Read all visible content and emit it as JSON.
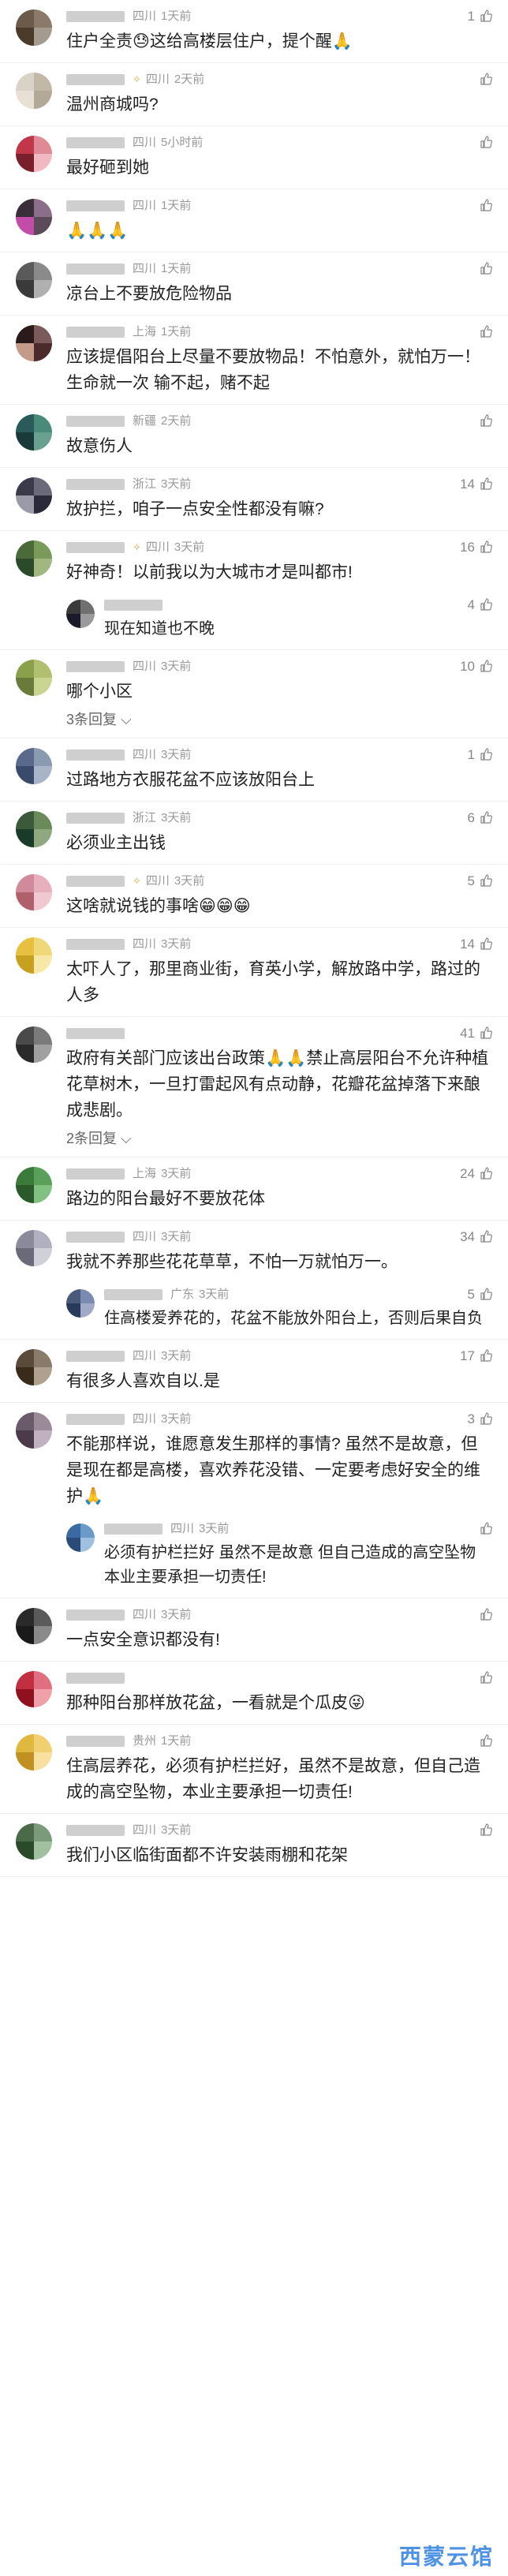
{
  "comments": [
    {
      "region": "四川",
      "time": "1天前",
      "likes": "1",
      "text": "住户全责😓这给高楼层住户，提个醒🙏",
      "av": [
        "#6b5b4b",
        "#8b7a6a",
        "#4a3a2a",
        "#a59a8f"
      ]
    },
    {
      "region": "四川",
      "time": "2天前",
      "likes": "",
      "badge": true,
      "text": "温州商城吗?",
      "av": [
        "#d9d2c6",
        "#c2b8a8",
        "#e8e0d4",
        "#b4a898"
      ]
    },
    {
      "region": "四川",
      "time": "5小时前",
      "likes": "",
      "text": "最好砸到她",
      "av": [
        "#c2364a",
        "#e08a96",
        "#7a1f2c",
        "#f0b8c0"
      ]
    },
    {
      "region": "四川",
      "time": "1天前",
      "likes": "",
      "text": "🙏🙏🙏",
      "av": [
        "#3a2e3a",
        "#8a6e8a",
        "#c24ca8",
        "#5a4a5a"
      ]
    },
    {
      "region": "四川",
      "time": "1天前",
      "likes": "",
      "text": "凉台上不要放危险物品",
      "av": [
        "#5a5a5a",
        "#8a8a8a",
        "#3a3a3a",
        "#b0b0b0"
      ]
    },
    {
      "region": "上海",
      "time": "1天前",
      "likes": "",
      "text": "应该提倡阳台上尽量不要放物品！不怕意外，就怕万一！生命就一次 输不起，赌不起",
      "av": [
        "#2a1a1a",
        "#7a5a5a",
        "#c49a8a",
        "#4a2a2a"
      ]
    },
    {
      "region": "新疆",
      "time": "2天前",
      "likes": "",
      "text": "故意伤人",
      "av": [
        "#2a5a5a",
        "#4a8a7a",
        "#1a3a3a",
        "#6aa090"
      ]
    },
    {
      "region": "浙江",
      "time": "3天前",
      "likes": "14",
      "text": "放护拦，咱子一点安全性都没有嘛?",
      "av": [
        "#3a3a4a",
        "#6a6a7a",
        "#9a9aa8",
        "#2a2a3a"
      ]
    },
    {
      "region": "四川",
      "time": "3天前",
      "likes": "16",
      "badge": true,
      "text": "好神奇！以前我以为大城市才是叫都市!",
      "av": [
        "#4a6a3a",
        "#7a9a5a",
        "#2a4a2a",
        "#a0b880"
      ],
      "sub": {
        "likes": "4",
        "text": "现在知道也不晚",
        "av": [
          "#3a3a3a",
          "#707070",
          "#1a1a2a",
          "#9a9a9a"
        ]
      }
    },
    {
      "region": "四川",
      "time": "3天前",
      "likes": "10",
      "text": "哪个小区",
      "reply": "3条回复",
      "av": [
        "#8aa04a",
        "#b0c070",
        "#6a7a3a",
        "#c8d490"
      ]
    },
    {
      "region": "四川",
      "time": "3天前",
      "likes": "1",
      "text": "过路地方衣服花盆不应该放阳台上",
      "av": [
        "#5a6a8a",
        "#8a9ab0",
        "#3a4a6a",
        "#aab4c8"
      ]
    },
    {
      "region": "浙江",
      "time": "3天前",
      "likes": "6",
      "text": "必须业主出钱",
      "av": [
        "#3a5a3a",
        "#6a8a5a",
        "#1a3a2a",
        "#90a880"
      ]
    },
    {
      "region": "四川",
      "time": "3天前",
      "likes": "5",
      "badge": true,
      "text": "这啥就说钱的事啥😁😁😁",
      "av": [
        "#d08a9a",
        "#e8b0bc",
        "#b0606a",
        "#f0c8d0"
      ]
    },
    {
      "region": "四川",
      "time": "3天前",
      "likes": "14",
      "text": "太吓人了，那里商业街，育英小学，解放路中学，路过的人多",
      "av": [
        "#e8c040",
        "#f0d878",
        "#c8a020",
        "#f8e8a8"
      ]
    },
    {
      "region": "",
      "time": "",
      "likes": "41",
      "text": "政府有关部门应该出台政策🙏🙏禁止高层阳台不允许种植花草树木，一旦打雷起风有点动静，花瓣花盆掉落下来酿成悲剧。",
      "reply": "2条回复",
      "av": [
        "#4a4a4a",
        "#7a7a7a",
        "#2a2a2a",
        "#a0a0a0"
      ]
    },
    {
      "region": "上海",
      "time": "3天前",
      "likes": "24",
      "text": "路边的阳台最好不要放花体",
      "av": [
        "#3a7a3a",
        "#5aa05a",
        "#2a5a2a",
        "#80c080"
      ]
    },
    {
      "region": "四川",
      "time": "3天前",
      "likes": "34",
      "text": "我就不养那些花花草草，不怕一万就怕万一。",
      "av": [
        "#8a8a9a",
        "#b0b0c0",
        "#6a6a7a",
        "#d0d0d8"
      ],
      "sub": {
        "region": "广东",
        "time": "3天前",
        "likes": "5",
        "text": "住高楼爱养花的，花盆不能放外阳台上，否则后果自负",
        "av": [
          "#4a5a7a",
          "#7a8ab0",
          "#2a3a5a",
          "#a0aac8"
        ]
      }
    },
    {
      "region": "四川",
      "time": "3天前",
      "likes": "17",
      "text": "有很多人喜欢自以.是",
      "av": [
        "#5a4a3a",
        "#8a7a6a",
        "#3a2a1a",
        "#b0a090"
      ]
    },
    {
      "region": "四川",
      "time": "3天前",
      "likes": "3",
      "text": "不能那样说，谁愿意发生那样的事情? 虽然不是故意，但是现在都是高楼，喜欢养花没错、一定要考虑好安全的维护🙏",
      "av": [
        "#6a5a6a",
        "#9a8a9a",
        "#4a3a4a",
        "#c0b0c0"
      ],
      "sub": {
        "region": "四川",
        "time": "3天前",
        "likes": "",
        "text": "必须有护栏拦好 虽然不是故意 但自己造成的高空坠物 本业主要承担一切责任!",
        "av": [
          "#3a6aa0",
          "#6a9ac8",
          "#2a4a7a",
          "#a0c0e0"
        ]
      }
    },
    {
      "region": "四川",
      "time": "3天前",
      "likes": "",
      "text": "一点安全意识都没有!",
      "av": [
        "#2a2a2a",
        "#5a5a5a",
        "#1a1a1a",
        "#8a8a8a"
      ]
    },
    {
      "region": "",
      "time": "",
      "likes": "",
      "text": "那种阳台那样放花盆，一看就是个瓜皮😜",
      "av": [
        "#c03040",
        "#e07080",
        "#901020",
        "#f0a0a8"
      ]
    },
    {
      "region": "贵州",
      "time": "1天前",
      "likes": "",
      "text": "住高层养花，必须有护栏拦好，虽然不是故意，但自己造成的高空坠物，本业主要承担一切责任!",
      "av": [
        "#e0b840",
        "#f0d070",
        "#c09020",
        "#f8e0a0"
      ]
    },
    {
      "region": "四川",
      "time": "3天前",
      "likes": "",
      "text": "我们小区临街面都不许安装雨棚和花架",
      "av": [
        "#4a6a4a",
        "#7a9a7a",
        "#2a4a2a",
        "#a0c0a0"
      ]
    }
  ],
  "watermark": "西蒙云馆",
  "icons": {
    "like": "thumbs-up-icon"
  }
}
